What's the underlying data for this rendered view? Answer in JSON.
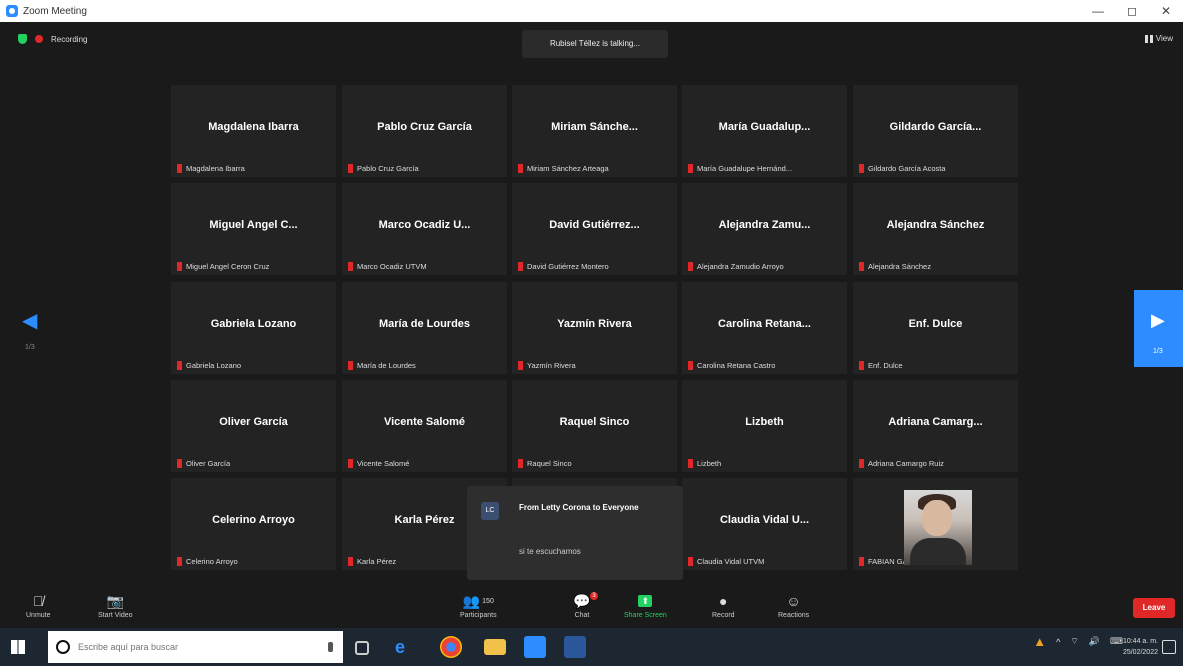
{
  "window": {
    "title": "Zoom Meeting",
    "controls": [
      "—",
      "◻",
      "✕"
    ]
  },
  "top": {
    "recording": "Recording",
    "talking": "Rubisel Téllez is talking...",
    "view": "View"
  },
  "nav": {
    "left_page": "1/3",
    "right_page": "1/3"
  },
  "participants": [
    {
      "name": "Magdalena Ibarra",
      "label": "Magdalena Ibarra"
    },
    {
      "name": "Pablo Cruz García",
      "label": "Pablo Cruz García"
    },
    {
      "name": "Miriam  Sánche...",
      "label": "Miriam  Sánchez Arteaga"
    },
    {
      "name": "María  Guadalup...",
      "label": "María Guadalupe Hernánd..."
    },
    {
      "name": "Gildardo  García...",
      "label": "Gildardo García Acosta"
    },
    {
      "name": "Miguel  Angel  C...",
      "label": "Miguel Angel Ceron Cruz"
    },
    {
      "name": "Marco  Ocadiz  U...",
      "label": "Marco Ocadiz UTVM"
    },
    {
      "name": "David  Gutiérrez...",
      "label": "David Gutiérrez Montero"
    },
    {
      "name": "Alejandra  Zamu...",
      "label": "Alejandra Zamudio Arroyo"
    },
    {
      "name": "Alejandra Sánchez",
      "label": "Alejandra Sánchez"
    },
    {
      "name": "Gabriela Lozano",
      "label": "Gabriela Lozano"
    },
    {
      "name": "María de Lourdes",
      "label": "María de Lourdes"
    },
    {
      "name": "Yazmín Rivera",
      "label": "Yazmín Rivera"
    },
    {
      "name": "Carolina  Retana...",
      "label": "Carolina Retana Castro"
    },
    {
      "name": "Enf. Dulce",
      "label": "Enf. Dulce"
    },
    {
      "name": "Oliver García",
      "label": "Oliver García"
    },
    {
      "name": "Vicente Salomé",
      "label": "Vicente Salomé"
    },
    {
      "name": "Raquel Sinco",
      "label": "Raquel Sinco"
    },
    {
      "name": "Lizbeth",
      "label": "Lizbeth"
    },
    {
      "name": "Adriana  Camarg...",
      "label": "Adriana Camargo Ruiz"
    },
    {
      "name": "Celerino Arroyo",
      "label": "Celerino Arroyo"
    },
    {
      "name": "Karla Pérez",
      "label": "Karla Pérez"
    },
    {
      "name": "",
      "label": ""
    },
    {
      "name": "Claudia  Vidal  U...",
      "label": "Claudia Vidal UTVM"
    },
    {
      "name": "",
      "label": "FABIAN GALVEZ"
    }
  ],
  "chat": {
    "initials": "LC",
    "from": "From Letty Corona to Everyone",
    "message": "si te escuchamos"
  },
  "toolbar": {
    "unmute": "Unmute",
    "start_video": "Start Video",
    "participants": "Participants",
    "participants_count": "150",
    "chat": "Chat",
    "chat_badge": "3",
    "share": "Share Screen",
    "record": "Record",
    "reactions": "Reactions",
    "leave": "Leave"
  },
  "taskbar": {
    "search_placeholder": "Escribe aquí para buscar",
    "time": "10:44 a. m.",
    "date": "25/02/2022"
  },
  "colors": {
    "accent": "#2d8cff",
    "mute_red": "#e02828",
    "share_green": "#23d160"
  }
}
